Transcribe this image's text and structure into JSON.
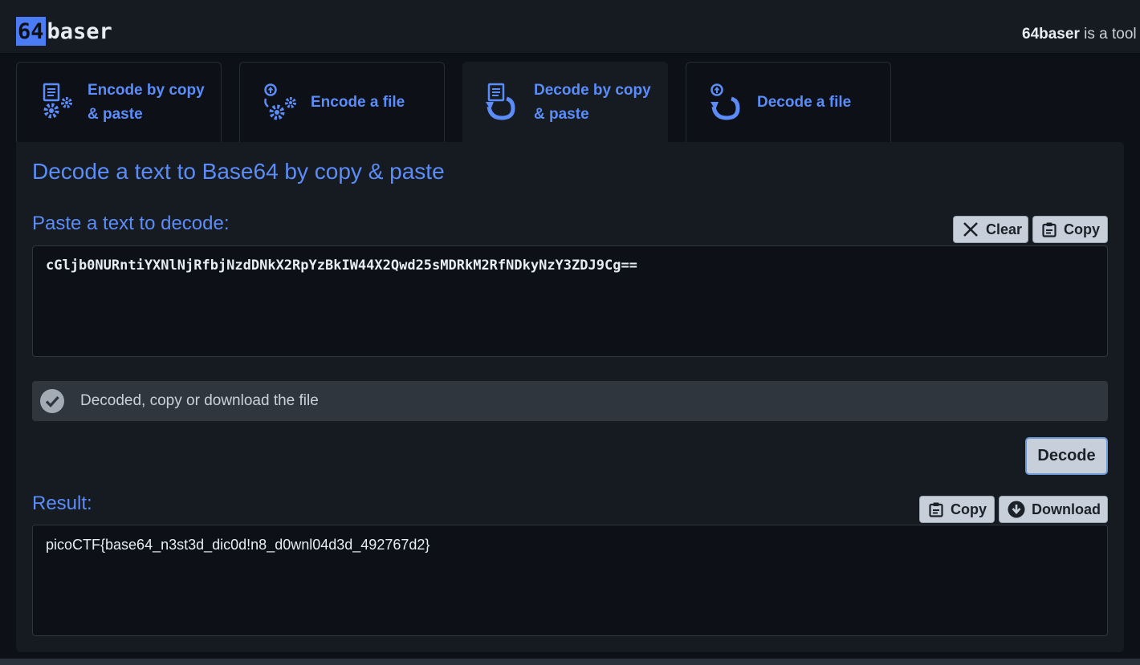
{
  "header": {
    "logo_num": "64",
    "logo_word": "baser",
    "tagline_brand": "64baser",
    "tagline_rest": " is a tool"
  },
  "tabs": [
    {
      "label": "Encode by copy & paste",
      "icon": "encode-text-icon",
      "active": false
    },
    {
      "label": "Encode a file",
      "icon": "encode-file-icon",
      "active": false
    },
    {
      "label": "Decode by copy & paste",
      "icon": "decode-text-icon",
      "active": true
    },
    {
      "label": "Decode a file",
      "icon": "decode-file-icon",
      "active": false
    }
  ],
  "main": {
    "title": "Decode a text to Base64 by copy & paste",
    "input_label": "Paste a text to decode:",
    "clear_label": "Clear",
    "copy_label": "Copy",
    "input_value": "cGljb0NURntiYXNlNjRfbjNzdDNkX2RpYzBkIW44X2Qwd25sMDRkM2RfNDkyNzY3ZDJ9Cg==",
    "status_text": "Decoded, copy or download the file",
    "decode_label": "Decode",
    "result_label": "Result:",
    "result_copy_label": "Copy",
    "download_label": "Download",
    "result_value": "picoCTF{base64_n3st3d_dic0d!n8_d0wnl04d3d_492767d2}"
  },
  "colors": {
    "accent": "#5b8cf7",
    "background": "#0d1117",
    "panel": "#161b22",
    "button": "#c7d0da"
  }
}
